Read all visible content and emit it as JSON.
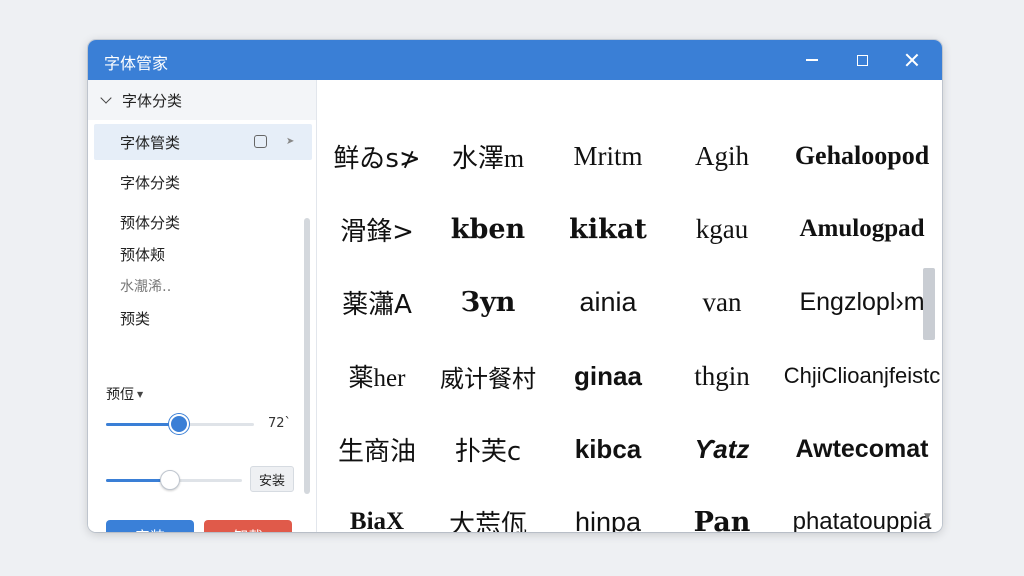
{
  "window": {
    "title": "字体管家"
  },
  "sidebar": {
    "tree_header": "字体分类",
    "items": [
      {
        "label": "字体管类"
      },
      {
        "label": "字体分类"
      },
      {
        "label": "预体分类"
      },
      {
        "label": "预体颊"
      },
      {
        "label": "水㵾浠‥"
      },
      {
        "label": "预类"
      }
    ],
    "section_label": "预侸",
    "size_slider": {
      "value_label": "72`",
      "level": 0.49
    },
    "weight_slider": {
      "level": 0.47
    },
    "mini_install_label": "安装",
    "install_label": "安装",
    "uninstall_label": "卸载"
  },
  "font_grid": {
    "rows": [
      [
        "鲜ゐs≯",
        "水澤m",
        "Mritm",
        "Agih",
        "Gehaloopod"
      ],
      [
        "滑鋒>",
        "kben",
        "kikat",
        "kgau",
        "Amulogpad"
      ],
      [
        "薬瀟A",
        "Зyn",
        "ainia",
        "van",
        "Engzlopl›m"
      ],
      [
        "薬her",
        "威计餐村",
        "ginaa",
        "thgin",
        "ChjiClioanjfeistc"
      ],
      [
        "生商油",
        "扑芙c",
        "kibca",
        "Ƴatz",
        "Awtecomat"
      ],
      [
        "BiaX",
        "大莣佤",
        "hinpa",
        "Pan",
        "phatatouppia"
      ]
    ]
  },
  "colors": {
    "titlebar": "#3a7fd6",
    "install": "#3a80d8",
    "uninstall": "#e05a4a"
  },
  "icons": [
    "minimize-icon",
    "maximize-icon",
    "close-icon",
    "chevron-down-icon",
    "checkbox-icon",
    "pin-icon",
    "caret-down-icon",
    "scroll-down-icon"
  ]
}
